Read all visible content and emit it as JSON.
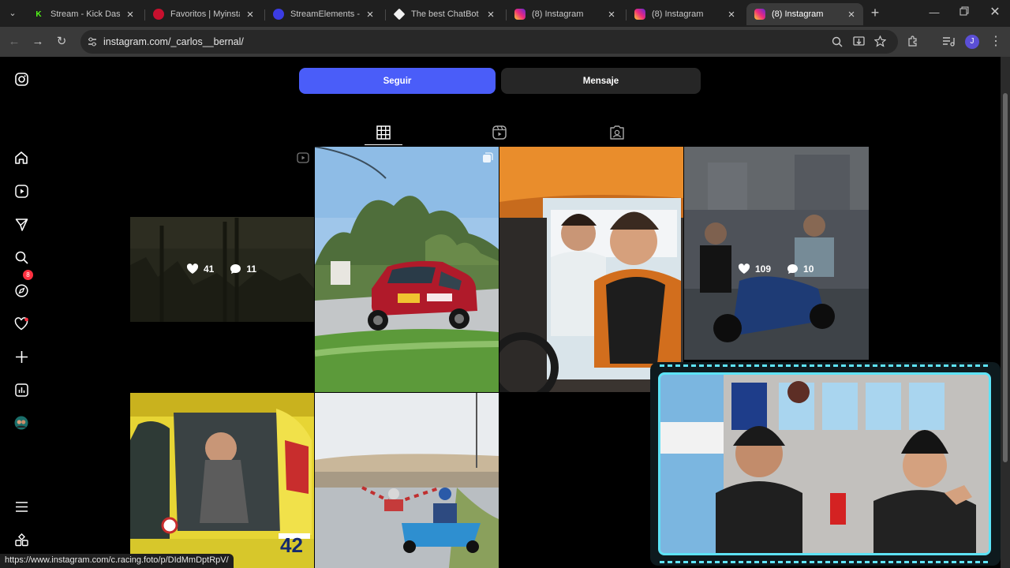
{
  "browser": {
    "tabs": [
      {
        "title": "Stream - Kick Dashboard",
        "favicon": "kick-icon",
        "favcolor": "#53fc18",
        "glyph": "K",
        "active": false
      },
      {
        "title": "Favoritos | Myinstants",
        "favicon": "myinstants-icon",
        "favcolor": "#c8102e",
        "glyph": "",
        "active": false
      },
      {
        "title": "StreamElements - Su",
        "favicon": "streamelements-icon",
        "favcolor": "#3b3ce3",
        "glyph": "",
        "active": false
      },
      {
        "title": "The best ChatBot and",
        "favicon": "chatbot-icon",
        "favcolor": "#f2f2f2",
        "glyph": "",
        "active": false
      },
      {
        "title": "(8) Instagram",
        "favicon": "instagram-icon",
        "favcolor": "#e1306c",
        "glyph": "",
        "active": false
      },
      {
        "title": "(8) Instagram",
        "favicon": "instagram-icon",
        "favcolor": "#e1306c",
        "glyph": "",
        "active": false
      },
      {
        "title": "(8) Instagram",
        "favicon": "instagram-icon",
        "favcolor": "#e1306c",
        "glyph": "",
        "active": true
      }
    ],
    "url": "instagram.com/_carlos__bernal/",
    "profile_initial": "J",
    "status_url": "https://www.instagram.com/c.racing.foto/p/DIdMmDptRpV/"
  },
  "instagram": {
    "sidebar_badge": "8",
    "follow_label": "Seguir",
    "message_label": "Mensaje",
    "colors": {
      "follow": "#4a5df9",
      "message": "#262626",
      "accent": "#ff3040"
    },
    "posts": [
      {
        "likes": "41",
        "comments": "11",
        "hover": true
      },
      {
        "likes": "",
        "comments": "",
        "hover": false
      },
      {
        "likes": "",
        "comments": "",
        "hover": false
      },
      {
        "likes": "109",
        "comments": "10",
        "hover": true
      },
      {
        "likes": "",
        "comments": "",
        "hover": false
      },
      {
        "likes": "",
        "comments": "",
        "hover": false
      }
    ],
    "rally_plate": "42"
  }
}
